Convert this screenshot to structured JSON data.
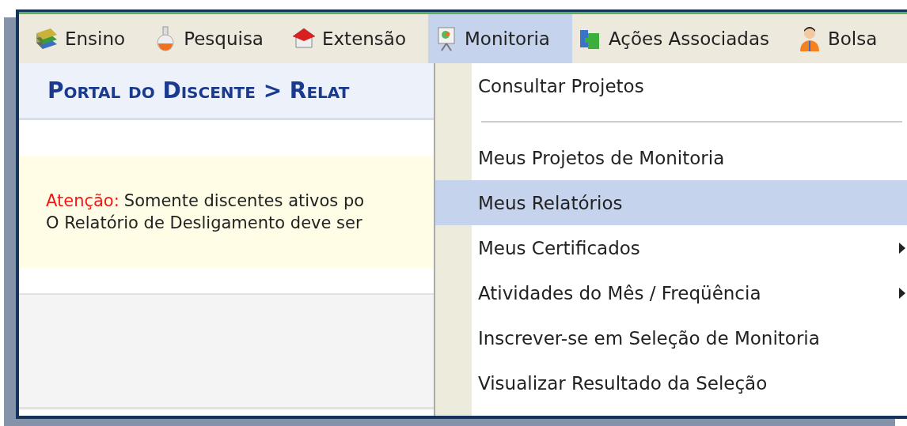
{
  "menu_bar": {
    "items": [
      {
        "label": "Ensino",
        "selected": false
      },
      {
        "label": "Pesquisa",
        "selected": false
      },
      {
        "label": "Extensão",
        "selected": false
      },
      {
        "label": "Monitoria",
        "selected": true
      },
      {
        "label": "Ações Associadas",
        "selected": false
      },
      {
        "label": "Bolsa",
        "selected": false
      }
    ]
  },
  "breadcrumb": "Portal do Discente > Relat",
  "notice": {
    "label": "Atenção:",
    "lines": [
      "Somente discentes ativos po",
      "O Relatório de Desligamento deve ser"
    ]
  },
  "dropdown": {
    "items": [
      {
        "kind": "item",
        "label": "Consultar Projetos",
        "selected": false,
        "submenu": false
      },
      {
        "kind": "separator"
      },
      {
        "kind": "item",
        "label": "Meus Projetos de Monitoria",
        "selected": false,
        "submenu": false
      },
      {
        "kind": "item",
        "label": "Meus Relatórios",
        "selected": true,
        "submenu": false
      },
      {
        "kind": "item",
        "label": "Meus Certificados",
        "selected": false,
        "submenu": true
      },
      {
        "kind": "item",
        "label": "Atividades do Mês / Freqüência",
        "selected": false,
        "submenu": true
      },
      {
        "kind": "item",
        "label": "Inscrever-se em Seleção de Monitoria",
        "selected": false,
        "submenu": false
      },
      {
        "kind": "item",
        "label": "Visualizar Resultado da Seleção",
        "selected": false,
        "submenu": false
      }
    ]
  }
}
